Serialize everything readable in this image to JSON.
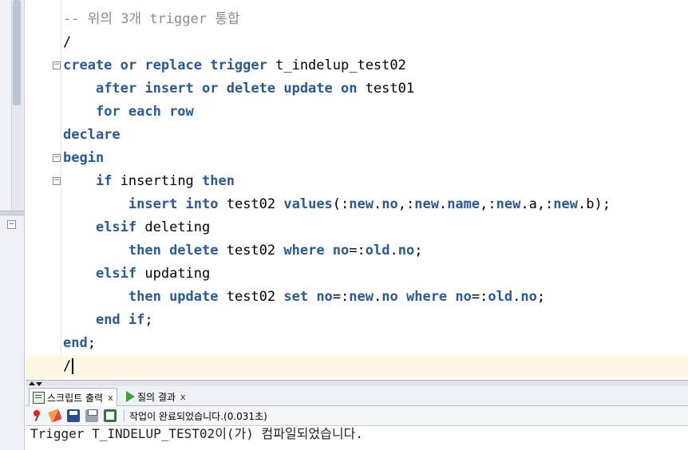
{
  "editor": {
    "lines": [
      {
        "parts": [
          [
            "cm",
            "-- 위의 3개 trigger 통합"
          ]
        ]
      },
      {
        "parts": [
          [
            "t",
            "/"
          ]
        ]
      },
      {
        "fold": true,
        "parts": [
          [
            "kw",
            "create or replace trigger"
          ],
          [
            "t",
            " t_indelup_test02"
          ]
        ]
      },
      {
        "parts": [
          [
            "t",
            "    "
          ],
          [
            "kw",
            "after insert or delete update on"
          ],
          [
            "t",
            " test01"
          ]
        ]
      },
      {
        "parts": [
          [
            "t",
            "    "
          ],
          [
            "kw",
            "for each row"
          ]
        ]
      },
      {
        "parts": [
          [
            "kw",
            "declare"
          ]
        ]
      },
      {
        "fold": true,
        "parts": [
          [
            "kw",
            "begin"
          ]
        ]
      },
      {
        "fold": true,
        "parts": [
          [
            "t",
            "    "
          ],
          [
            "kw",
            "if"
          ],
          [
            "t",
            " inserting "
          ],
          [
            "kw",
            "then"
          ]
        ]
      },
      {
        "parts": [
          [
            "t",
            "        "
          ],
          [
            "kw",
            "insert into"
          ],
          [
            "t",
            " test02 "
          ],
          [
            "kw",
            "values"
          ],
          [
            "t",
            "(:"
          ],
          [
            "kw",
            "new"
          ],
          [
            "t",
            "."
          ],
          [
            "kw",
            "no"
          ],
          [
            "t",
            ",:"
          ],
          [
            "kw",
            "new"
          ],
          [
            "t",
            "."
          ],
          [
            "kw",
            "name"
          ],
          [
            "t",
            ",:"
          ],
          [
            "kw",
            "new"
          ],
          [
            "t",
            ".a,:"
          ],
          [
            "kw",
            "new"
          ],
          [
            "t",
            ".b);"
          ]
        ]
      },
      {
        "parts": [
          [
            "t",
            "    "
          ],
          [
            "kw",
            "elsif"
          ],
          [
            "t",
            " deleting"
          ]
        ]
      },
      {
        "parts": [
          [
            "t",
            "        "
          ],
          [
            "kw",
            "then delete"
          ],
          [
            "t",
            " test02 "
          ],
          [
            "kw",
            "where no"
          ],
          [
            "t",
            "=:"
          ],
          [
            "kw",
            "old"
          ],
          [
            "t",
            "."
          ],
          [
            "kw",
            "no"
          ],
          [
            "t",
            ";"
          ]
        ]
      },
      {
        "parts": [
          [
            "t",
            "    "
          ],
          [
            "kw",
            "elsif"
          ],
          [
            "t",
            " updating"
          ]
        ]
      },
      {
        "parts": [
          [
            "t",
            "        "
          ],
          [
            "kw",
            "then update"
          ],
          [
            "t",
            " test02 "
          ],
          [
            "kw",
            "set no"
          ],
          [
            "t",
            "=:"
          ],
          [
            "kw",
            "new"
          ],
          [
            "t",
            "."
          ],
          [
            "kw",
            "no"
          ],
          [
            "t",
            " "
          ],
          [
            "kw",
            "where no"
          ],
          [
            "t",
            "=:"
          ],
          [
            "kw",
            "old"
          ],
          [
            "t",
            "."
          ],
          [
            "kw",
            "no"
          ],
          [
            "t",
            ";"
          ]
        ]
      },
      {
        "parts": [
          [
            "t",
            "    "
          ],
          [
            "kw",
            "end if"
          ],
          [
            "t",
            ";"
          ]
        ]
      },
      {
        "parts": [
          [
            "kw",
            "end"
          ],
          [
            "t",
            ";"
          ]
        ]
      },
      {
        "current": true,
        "parts": [
          [
            "t",
            "/"
          ]
        ]
      }
    ]
  },
  "output": {
    "tabs": [
      {
        "label": "스크립트 출력",
        "close": "x"
      },
      {
        "label": "질의 결과",
        "close": "x"
      }
    ],
    "status": "작업이 완료되었습니다.(0.031초)",
    "message": "Trigger T_INDELUP_TEST02이(가) 컴파일되었습니다."
  }
}
